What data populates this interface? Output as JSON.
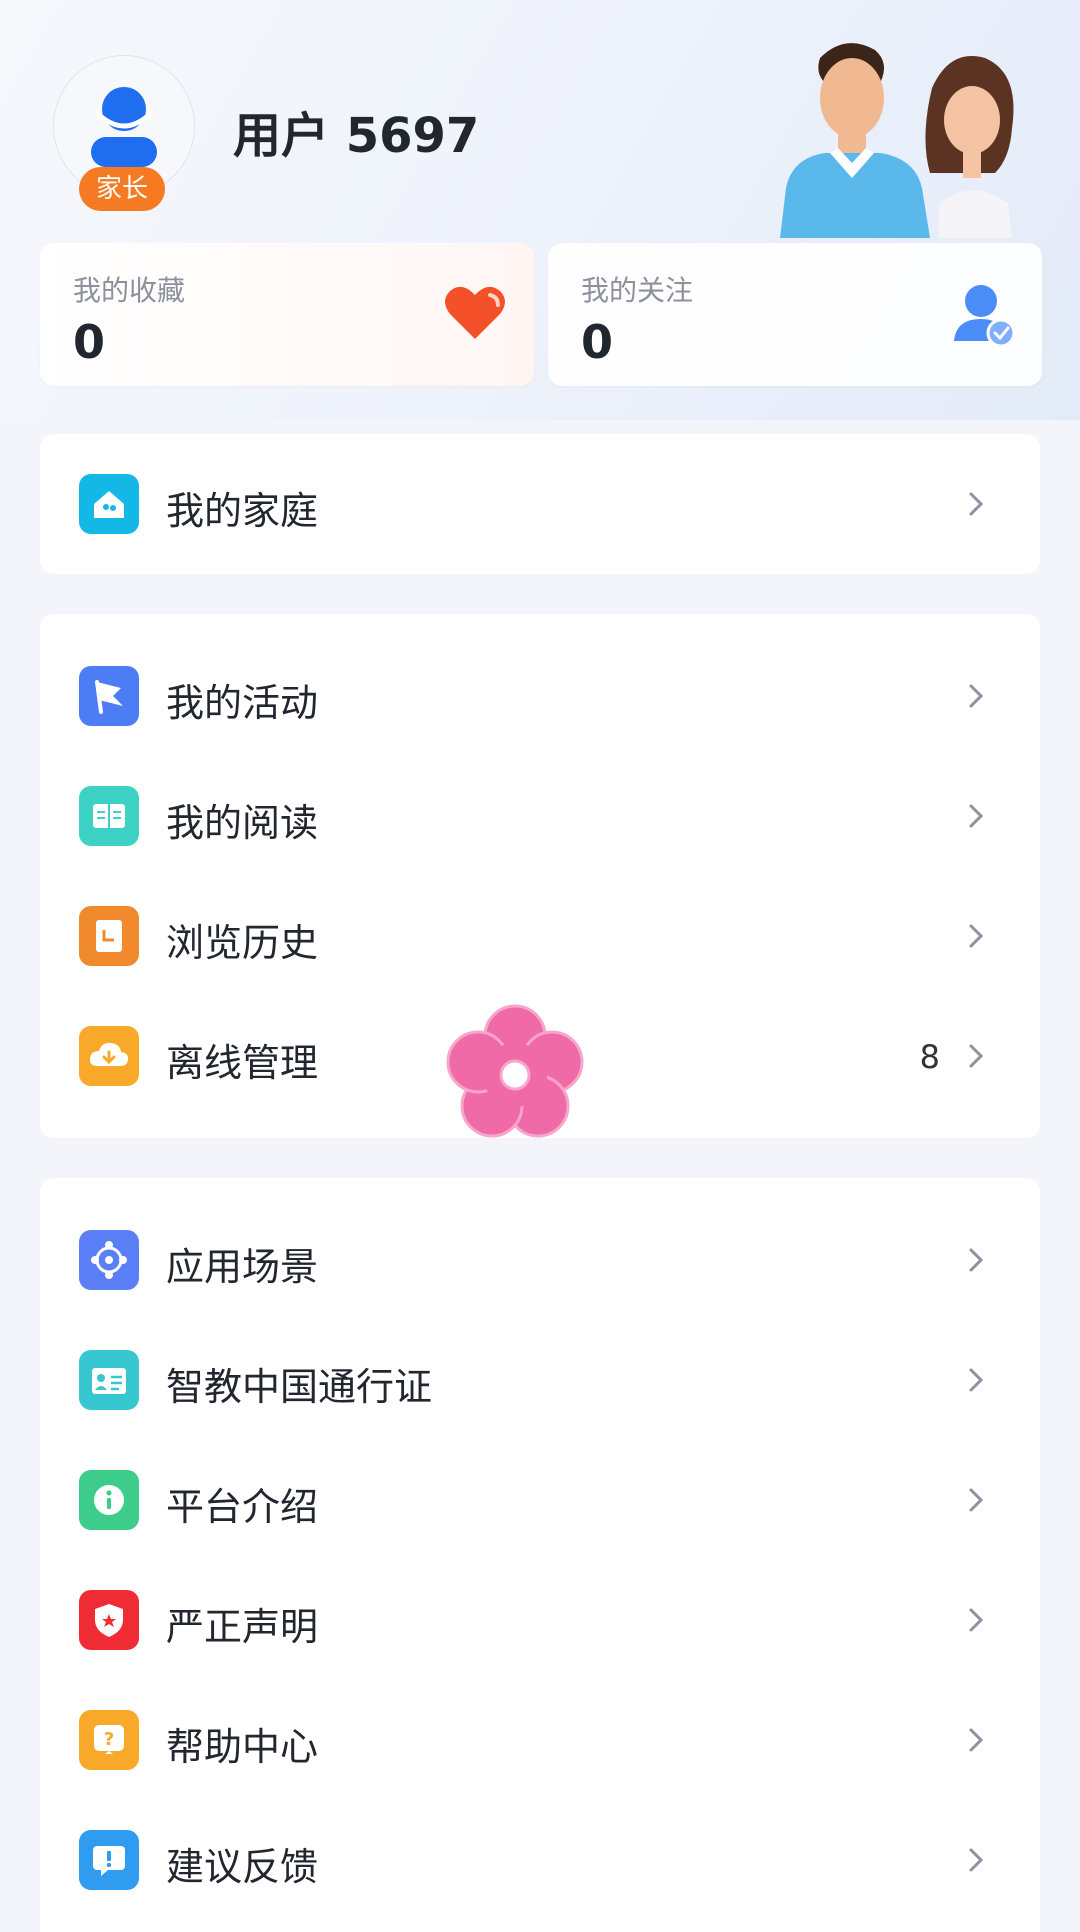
{
  "header": {
    "username": "用户 5697",
    "role_badge": "家长",
    "avatar_icon": "user-avatar-icon",
    "illustration_icon": "parents-illustration"
  },
  "stats": [
    {
      "label": "我的收藏",
      "value": "0",
      "icon": "heart-icon",
      "color": "#f4502a"
    },
    {
      "label": "我的关注",
      "value": "0",
      "icon": "user-check-icon",
      "color": "#4b8df8"
    }
  ],
  "menu_groups": [
    {
      "items": [
        {
          "label": "我的家庭",
          "icon": "home-icon",
          "color": "#13b8e6"
        }
      ]
    },
    {
      "items": [
        {
          "label": "我的活动",
          "icon": "flag-icon",
          "color": "#4d7df5"
        },
        {
          "label": "我的阅读",
          "icon": "book-icon",
          "color": "#3cd3c4"
        },
        {
          "label": "浏览历史",
          "icon": "history-icon",
          "color": "#f08a2c"
        },
        {
          "label": "离线管理",
          "icon": "cloud-download-icon",
          "color": "#f9a92a",
          "count": "8"
        }
      ]
    },
    {
      "items": [
        {
          "label": "应用场景",
          "icon": "scenes-icon",
          "color": "#5b7ff6"
        },
        {
          "label": "智教中国通行证",
          "icon": "id-card-icon",
          "color": "#36c7d0"
        },
        {
          "label": "平台介绍",
          "icon": "info-icon",
          "color": "#3dcc8a"
        },
        {
          "label": "严正声明",
          "icon": "shield-icon",
          "color": "#ef2b33"
        },
        {
          "label": "帮助中心",
          "icon": "help-icon",
          "color": "#f9a92a"
        },
        {
          "label": "建议反馈",
          "icon": "feedback-icon",
          "color": "#2f9cf0"
        }
      ]
    }
  ],
  "overlay": {
    "icon": "pink-flower-sticker"
  },
  "colors": {
    "accent_orange": "#f57a22",
    "chevron": "#8c92a0",
    "background": "#f3f5fa"
  }
}
